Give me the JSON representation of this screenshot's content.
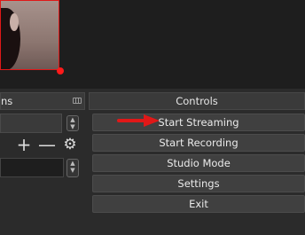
{
  "sources_dock": {
    "title_fragment": "ns"
  },
  "controls_dock": {
    "title": "Controls"
  },
  "controls": {
    "start_streaming": "Start Streaming",
    "start_recording": "Start Recording",
    "studio_mode": "Studio Mode",
    "settings": "Settings",
    "exit": "Exit"
  },
  "toolbar": {
    "add_symbol": "+",
    "remove_symbol": "—",
    "settings_symbol": "⚙"
  },
  "colors": {
    "annotation_arrow": "#e01818",
    "selection_border": "#e01818"
  },
  "icons": [
    "float-dock-icon",
    "add-icon",
    "remove-icon",
    "gear-icon",
    "spinner-icon",
    "arrow-annotation-icon"
  ]
}
